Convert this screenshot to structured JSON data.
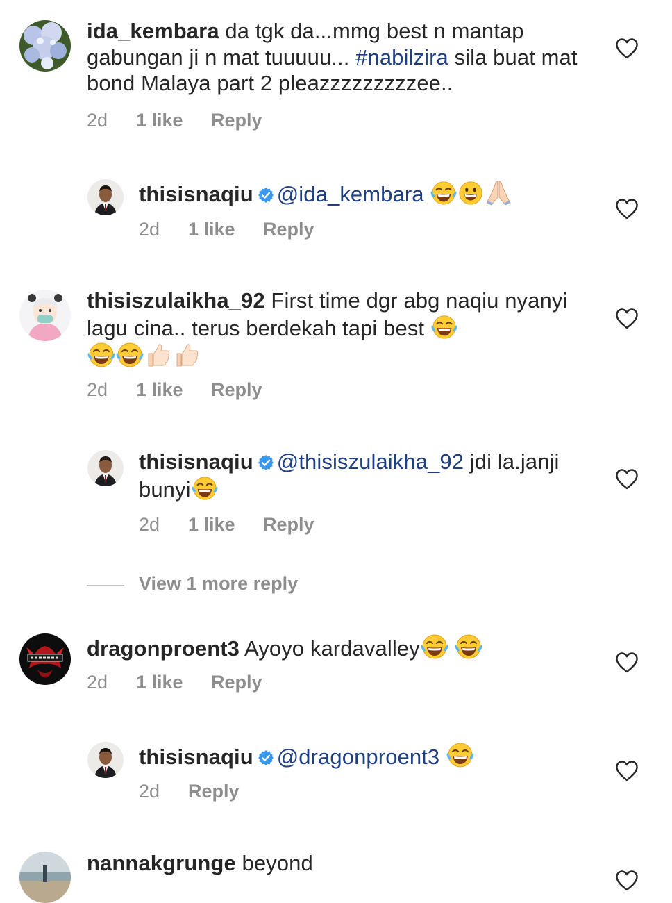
{
  "comments": [
    {
      "username": "ida_kembara",
      "text_before": " da tgk da...mmg best n mantap gabungan ji n mat tuuuuu... ",
      "hashtag": "#nabilzira",
      "text_after": " sila buat mat bond Malaya part 2 pleazzzzzzzzzee..",
      "time": "2d",
      "likes": "1 like",
      "reply": "Reply",
      "avatar": "hydrangea-flowers"
    },
    {
      "username": "thisisnaqiu",
      "mention": "@ida_kembara",
      "text": "",
      "emojis": [
        "tears-of-joy",
        "grinning",
        "folded-hands"
      ],
      "time": "2d",
      "likes": "1 like",
      "reply": "Reply",
      "avatar": "man-in-suit"
    },
    {
      "username": "thisiszulaikha_92",
      "text": " First time dgr abg naqiu nyanyi lagu cina.. terus berdekah tapi best ",
      "emojis": [
        "tears-of-joy",
        "tears-of-joy",
        "tears-of-joy",
        "thumbs-up",
        "thumbs-up"
      ],
      "time": "2d",
      "likes": "1 like",
      "reply": "Reply",
      "avatar": "cartoon-girl"
    },
    {
      "username": "thisisnaqiu",
      "mention": "@thisiszulaikha_92",
      "text": " jdi la.janji bunyi",
      "emojis": [
        "tears-of-joy"
      ],
      "time": "2d",
      "likes": "1 like",
      "reply": "Reply",
      "avatar": "man-in-suit"
    },
    {
      "username": "dragonproent3",
      "text": " Ayoyo kardavalley",
      "emojis": [
        "tears-of-joy",
        "tears-of-joy"
      ],
      "time": "2d",
      "likes": "1 like",
      "reply": "Reply",
      "avatar": "dragon-logo"
    },
    {
      "username": "thisisnaqiu",
      "mention": "@dragonproent3",
      "text": " ",
      "emojis": [
        "tears-of-joy"
      ],
      "time": "2d",
      "likes": "",
      "reply": "Reply",
      "avatar": "man-in-suit"
    },
    {
      "username": "nannakgrunge",
      "text": " beyond",
      "avatar": "beach-photo"
    }
  ],
  "view_more": "View 1 more reply",
  "colors": {
    "text": "#262626",
    "muted": "#8e8e8e",
    "link": "#1f3f83",
    "verified": "#3897f0"
  },
  "icons": [
    "heart-icon",
    "verified-badge-icon"
  ]
}
